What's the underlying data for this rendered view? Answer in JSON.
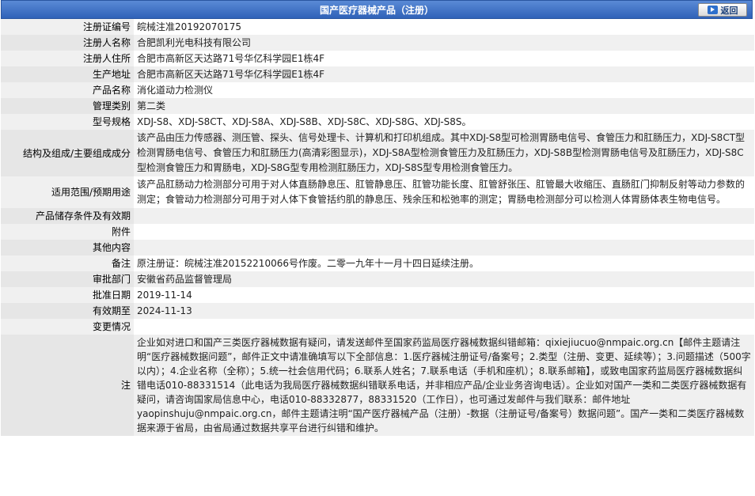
{
  "header": {
    "title": "国产医疗器械产品（注册）",
    "back_label": "返回"
  },
  "rows": [
    {
      "label": "注册证编号",
      "value": "皖械注准20192070175"
    },
    {
      "label": "注册人名称",
      "value": "合肥凯利光电科技有限公司"
    },
    {
      "label": "注册人住所",
      "value": "合肥市高新区天达路71号华亿科学园E1栋4F"
    },
    {
      "label": "生产地址",
      "value": "合肥市高新区天达路71号华亿科学园E1栋4F"
    },
    {
      "label": "产品名称",
      "value": "消化道动力检测仪"
    },
    {
      "label": "管理类别",
      "value": "第二类"
    },
    {
      "label": "型号规格",
      "value": "XDJ-S8、XDJ-S8CT、XDJ-S8A、XDJ-S8B、XDJ-S8C、XDJ-S8G、XDJ-S8S。"
    },
    {
      "label": "结构及组成/主要组成成分",
      "value": "该产品由压力传感器、测压管、探头、信号处理卡、计算机和打印机组成。其中XDJ-S8型可检测胃肠电信号、食管压力和肛肠压力，XDJ-S8CT型检测胃肠电信号、食管压力和肛肠压力(高清彩图显示)，XDJ-S8A型检测食管压力及肛肠压力，XDJ-S8B型检测胃肠电信号及肛肠压力，XDJ-S8C型检测食管压力和胃肠电，XDJ-S8G型专用检测肛肠压力，XDJ-S8S型专用检测食管压力。"
    },
    {
      "label": "适用范围/预期用途",
      "value": "该产品肛肠动力检测部分可用于对人体直肠静息压、肛管静息压、肛管功能长度、肛管舒张压、肛管最大收缩压、直肠肛门抑制反射等动力参数的测定；食管动力检测部分可用于对人体下食管括约肌的静息压、残余压和松弛率的测定；胃肠电检测部分可以检测人体胃肠体表生物电信号。"
    },
    {
      "label": "产品储存条件及有效期",
      "value": ""
    },
    {
      "label": "附件",
      "value": ""
    },
    {
      "label": "其他内容",
      "value": ""
    },
    {
      "label": "备注",
      "value": "原注册证：皖械注准20152210066号作废。二零一九年十一月十四日延续注册。"
    },
    {
      "label": "审批部门",
      "value": "安徽省药品监督管理局"
    },
    {
      "label": "批准日期",
      "value": "2019-11-14"
    },
    {
      "label": "有效期至",
      "value": "2024-11-13"
    },
    {
      "label": "变更情况",
      "value": ""
    }
  ],
  "note": {
    "label": "注",
    "value": "企业如对进口和国产三类医疗器械数据有疑问，请发送邮件至国家药监局医疗器械数据纠错邮箱：qixiejiucuo@nmpaic.org.cn【邮件主题请注明“医疗器械数据问题”，邮件正文中请准确填写以下全部信息：1.医疗器械注册证号/备案号；2.类型（注册、变更、延续等）；3.问题描述（500字以内）；4.企业名称（全称）；5.统一社会信用代码；6.联系人姓名；7.联系电话（手机和座机）；8.联系邮箱】，或致电国家药监局医疗器械数据纠错电话010-88331514（此电话为我局医疗器械数据纠错联系电话，并非相应产品/企业业务咨询电话）。企业如对国产一类和二类医疗器械数据有疑问，请咨询国家局信息中心，电话010-88332877，88331520（工作日），也可通过发邮件与我们联系：邮件地址yaopinshuju@nmpaic.org.cn，邮件主题请注明“国产医疗器械产品（注册）-数据（注册证号/备案号）数据问题”。国产一类和二类医疗器械数据来源于省局，由省局通过数据共享平台进行纠错和维护。"
  }
}
